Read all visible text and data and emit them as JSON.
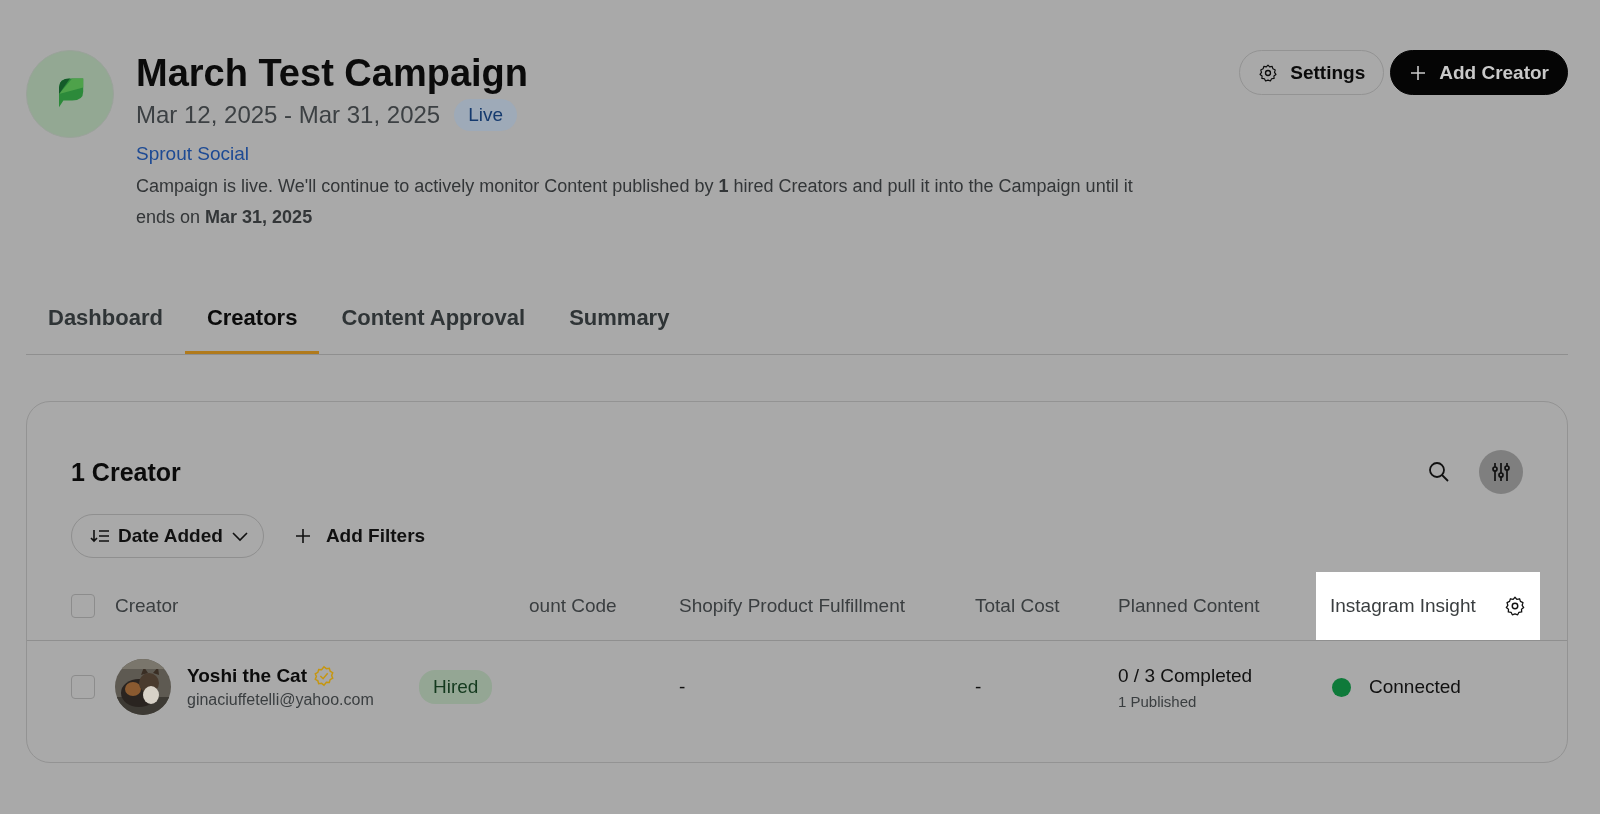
{
  "campaign": {
    "title": "March Test Campaign",
    "dates": "Mar 12, 2025 - Mar 31, 2025",
    "status": "Live",
    "brand": "Sprout Social",
    "description": "Campaign is live. We'll continue to actively monitor Content published by **1** hired Creators and pull it into the Campaign until it ends on **Mar 31, 2025**"
  },
  "actions": [
    {
      "label": "Settings",
      "kind": "secondary"
    },
    {
      "label": "Add Creator",
      "kind": "primary"
    }
  ],
  "tabs": [
    {
      "label": "Dashboard",
      "selected": false
    },
    {
      "label": "Creators",
      "selected": true
    },
    {
      "label": "Content Approval",
      "selected": false
    },
    {
      "label": "Summary",
      "selected": false
    }
  ],
  "panel": {
    "title": "1 Creator",
    "sort": "Date Added",
    "filter": "Add Filters"
  },
  "table": {
    "all_checked": false,
    "columns": [
      {
        "label": "Creator",
        "highlighted": false
      },
      {
        "label": "ount Code",
        "highlighted": false
      },
      {
        "label": "Shopify Product Fulfillment",
        "highlighted": false
      },
      {
        "label": "Total Cost",
        "highlighted": false
      },
      {
        "label": "Planned Content",
        "highlighted": false
      },
      {
        "label": "Instagram Insight",
        "highlighted": true
      }
    ],
    "rows": [
      {
        "checked": false,
        "name": "Yoshi the Cat",
        "verified": true,
        "email": "ginaciuffetelli@yahoo.com",
        "status": "Hired",
        "shopify": "-",
        "cost": "-",
        "planned": "0 / 3 Completed",
        "published": "1 Published",
        "insights": "Connected",
        "color": "#0e7a3a"
      }
    ]
  }
}
